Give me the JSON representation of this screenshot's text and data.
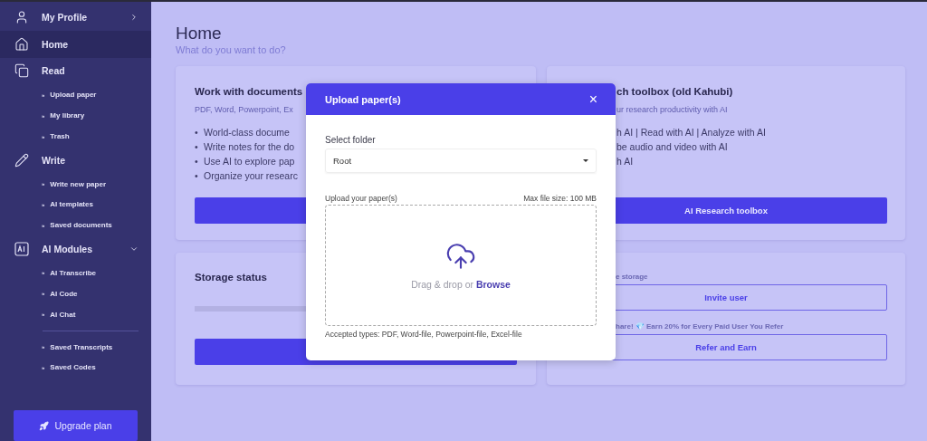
{
  "sidebar": {
    "items": [
      {
        "label": "My Profile",
        "kind": "menu",
        "selected": false
      },
      {
        "label": "Home",
        "kind": "link",
        "selected": true
      },
      {
        "label": "Read",
        "kind": "group",
        "selected": false,
        "children": [
          {
            "marker": "»",
            "label": "Upload paper"
          },
          {
            "marker": "»",
            "label": "My library"
          },
          {
            "marker": "»",
            "label": "Trash"
          }
        ]
      },
      {
        "label": "Write",
        "kind": "group",
        "selected": false,
        "children": [
          {
            "marker": "»",
            "label": "Write new paper"
          },
          {
            "marker": "»",
            "label": "AI templates"
          },
          {
            "marker": "»",
            "label": "Saved documents"
          }
        ]
      },
      {
        "label": "AI Modules",
        "kind": "group",
        "selected": false,
        "expanded": true,
        "children": [
          {
            "marker": "»",
            "label": "AI Transcribe"
          },
          {
            "marker": "»",
            "label": "AI Code"
          },
          {
            "marker": "»",
            "label": "AI Chat"
          }
        ],
        "more_children": [
          {
            "marker": "»",
            "label": "Saved Transcripts"
          },
          {
            "marker": "»",
            "label": "Saved Codes"
          }
        ]
      }
    ],
    "upgrade_button": "Upgrade plan"
  },
  "page": {
    "title": "Home",
    "subtitle": "What do you want to do?"
  },
  "cards": {
    "documents": {
      "title": "Work with documents",
      "subtitle": "PDF, Word, Powerpoint, Ex",
      "bullets": [
        {
          "marker": "•",
          "text": "World-class docume"
        },
        {
          "marker": "•",
          "text": "Write notes for the do"
        },
        {
          "marker": "•",
          "text": "Use AI to explore pap"
        },
        {
          "marker": "•",
          "text": "Organize your researc"
        }
      ]
    },
    "toolbox": {
      "title": "ch toolbox (old Kahubi)",
      "subtitle": "ur research productivity with AI",
      "lines": [
        "h AI | Read with AI | Analyze with AI",
        "be audio and video with AI",
        "h AI"
      ],
      "button": "AI Research toolbox"
    },
    "storage": {
      "title": "Storage status"
    },
    "invite": {
      "note": "e storage",
      "button": "Invite user",
      "share_note": "hare! 💎 Earn 20% for Every Paid User You Refer",
      "share_button": "Refer and Earn"
    }
  },
  "modal": {
    "title": "Upload paper(s)",
    "close": "×",
    "folder_label": "Select folder",
    "folder_value": "Root",
    "upload_label": "Upload your paper(s)",
    "max_size": "Max file size: 100 MB",
    "drop_text": "Drag & drop or ",
    "browse": "Browse",
    "accepted": "Accepted types: PDF, Word-file, Powerpoint-file, Excel-file"
  }
}
